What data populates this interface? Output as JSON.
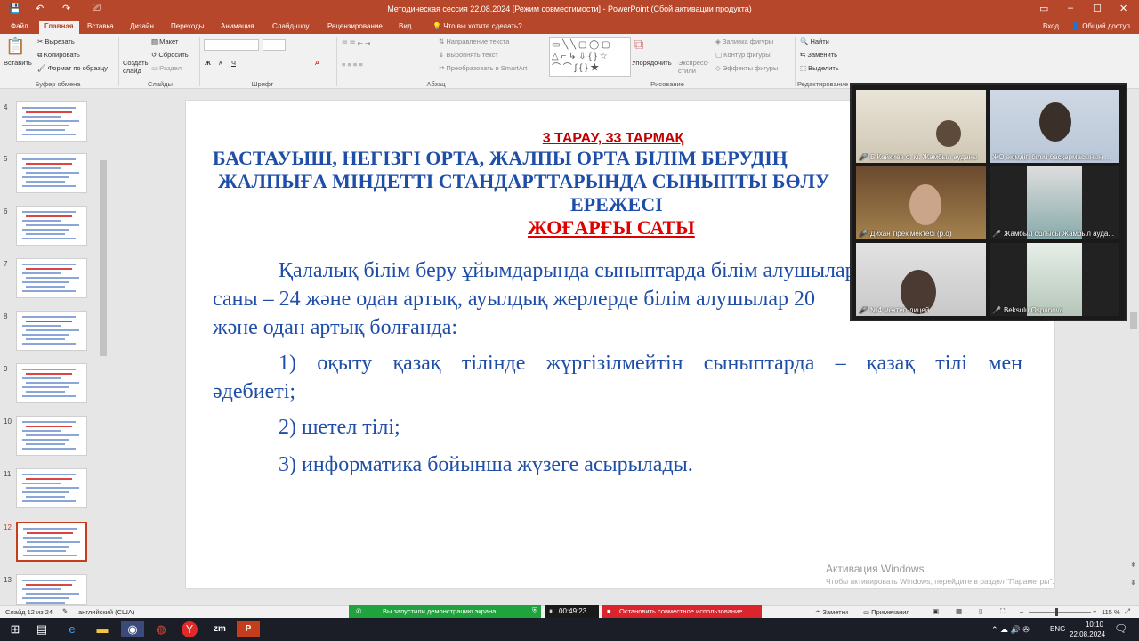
{
  "window": {
    "title": "Методическая сессия 22.08.2024 [Режим совместимости] - PowerPoint (Сбой активации продукта)"
  },
  "tabs": [
    "Файл",
    "Главная",
    "Вставка",
    "Дизайн",
    "Переходы",
    "Анимация",
    "Слайд-шоу",
    "Рецензирование",
    "Вид"
  ],
  "tell_me": "Что вы хотите сделать?",
  "login": "Вход",
  "share": "Общий доступ",
  "ribbon": {
    "paste": "Вставить",
    "cut": "Вырезать",
    "copy": "Копировать",
    "format_painter": "Формат по образцу",
    "new_slide": "Создать слайд",
    "layout": "Макет",
    "reset": "Сбросить",
    "section": "Раздел",
    "text_direction": "Направление текста",
    "align_text": "Выровнять текст",
    "smartart": "Преобразовать в SmartArt",
    "arrange": "Упорядочить",
    "quick_styles": "Экспресс-стили",
    "shape_fill": "Заливка фигуры",
    "shape_outline": "Контур фигуры",
    "shape_effects": "Эффекты фигуры",
    "find": "Найти",
    "replace": "Заменить",
    "select": "Выделить",
    "groups": [
      "Буфер обмена",
      "Слайды",
      "Шрифт",
      "Абзац",
      "Рисование",
      "Редактирование"
    ]
  },
  "thumbnails": [
    {
      "num": "4"
    },
    {
      "num": "5"
    },
    {
      "num": "6"
    },
    {
      "num": "7"
    },
    {
      "num": "8"
    },
    {
      "num": "9"
    },
    {
      "num": "10"
    },
    {
      "num": "11"
    },
    {
      "num": "12",
      "selected": true
    },
    {
      "num": "13"
    }
  ],
  "slide": {
    "section": "3 ТАРАУ, 33 ТАРМАҚ",
    "heading_line1": "БАСТАУЫШ, НЕГІЗГІ ОРТА, ЖАЛПЫ ОРТА БІЛІМ БЕРУДІҢ",
    "heading_line2": "ЖАЛПЫҒА МІНДЕТТІ СТАНДАРТТАРЫНДА СЫНЫПТЫ БӨЛУ",
    "heading_line3": "ЕРЕЖЕСІ",
    "level": "ЖОҒАРҒЫ САТЫ",
    "p1_line1": "Қалалық білім беру ұйымдарында сыныптарда білім алушылар",
    "p1_line2": "саны – 24 және одан артық, ауылдық жерлерде білім алушылар 20",
    "p1_line3": "және одан артық болғанда:",
    "item1_line1": "1) оқыту қазақ тілінде жүргізілмейтін сыныптарда – қазақ тілі мен",
    "item1_line2": "әдебиеті;",
    "item2": "2) шетел тілі;",
    "item3": "3) информатика бойынша жүзеге асырылады."
  },
  "activation": {
    "title": "Активация Windows",
    "sub": "Чтобы активировать Windows, перейдите в раздел \"Параметры\"."
  },
  "zoom": {
    "participants": [
      "Б.Кейкиев о. м. Жамбыл ауданы",
      "ЖО әкімдігі білім басқармасының ...",
      "Дихан тірек мектебі (р.о)",
      "Жамбыл облысы Жамбыл ауда...",
      "№4 мектеп-лицей",
      "Beksulu Ospanova"
    ],
    "share_notice": "Вы запустили демонстрацию экрана",
    "timer": "00:49:23",
    "stop": "Остановить совместное использование"
  },
  "status": {
    "slide": "Слайд 12 из 24",
    "lang": "английский (США)",
    "notes": "Заметки",
    "comments": "Примечания",
    "zoom": "115 %"
  },
  "taskbar": {
    "lang": "ENG",
    "time": "10:10",
    "date": "22.08.2024",
    "zm": "zm"
  },
  "colors": {
    "accent": "#b7472a",
    "heading": "#1f4ea8",
    "red": "#c00000"
  }
}
